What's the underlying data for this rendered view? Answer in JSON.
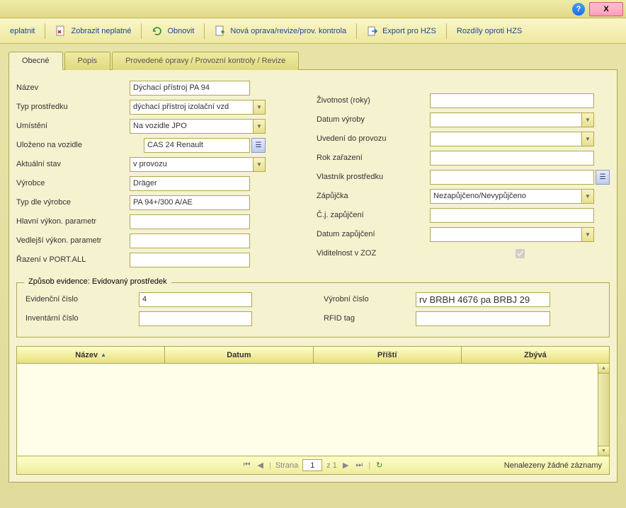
{
  "titlebar": {
    "close": "X"
  },
  "toolbar": {
    "invalidate": "eplatnit",
    "show_invalid": "Zobrazit neplatné",
    "refresh": "Obnovit",
    "new_repair": "Nová oprava/revize/prov. kontrola",
    "export_hzs": "Export pro HZS",
    "diff_hzs": "Rozdíly oproti HZS"
  },
  "tabs": {
    "general": "Obecné",
    "desc": "Popis",
    "repairs": "Provedené opravy / Provozní kontroly / Revize"
  },
  "labels": {
    "nazev": "Název",
    "typ_prostredku": "Typ prostředku",
    "umisteni": "Umístění",
    "ulozeno_vozidle": "Uloženo na vozidle",
    "aktualni_stav": "Aktuální stav",
    "vyrobce": "Výrobce",
    "typ_dle_vyrobce": "Typ dle výrobce",
    "hlavni_param": "Hlavní výkon. parametr",
    "vedlejsi_param": "Vedlejší výkon. parametr",
    "razeni": "Řazení v PORT.ALL",
    "zivotnost": "Životnost (roky)",
    "datum_vyroby": "Datum výroby",
    "uvedeni_provozu": "Uvedení do provozu",
    "rok_zarazeni": "Rok zařazení",
    "vlastnik": "Vlastník prostředku",
    "zapujcka": "Zápůjčka",
    "cj_zapujceni": "Č.j. zapůjčení",
    "datum_zapujceni": "Datum zapůjčení",
    "viditelnost": "Viditelnost v ZOZ",
    "evidencni_cislo": "Evidenční číslo",
    "inventarni_cislo": "Inventární číslo",
    "vyrobni_cislo": "Výrobní číslo",
    "rfid": "RFID tag"
  },
  "values": {
    "nazev": "Dýchací přístroj PA 94",
    "typ_prostredku": "dýchací přístroj izolační vzd",
    "umisteni": "Na vozidle JPO",
    "ulozeno_vozidle": "CAS 24 Renault",
    "aktualni_stav": "v provozu",
    "vyrobce": "Dräger",
    "typ_dle_vyrobce": "PA 94+/300 A/AE",
    "hlavni_param": "",
    "vedlejsi_param": "",
    "razeni": "",
    "zivotnost": "",
    "datum_vyroby": "",
    "uvedeni_provozu": "",
    "rok_zarazeni": "",
    "vlastnik": "",
    "zapujcka": "Nezapůjčeno/Nevypůjčeno",
    "cj_zapujceni": "",
    "datum_zapujceni": "",
    "evidencni_cislo": "4",
    "inventarni_cislo": "",
    "vyrobni_cislo": "rv BRBH 4676 pa BRBJ 29",
    "rfid": ""
  },
  "groupbox_legend": "Způsob evidence: Evidovaný prostředek",
  "grid": {
    "col_nazev": "Název",
    "col_datum": "Datum",
    "col_pristi": "Příští",
    "col_zbyva": "Zbývá",
    "page_label": "Strana",
    "page_value": "1",
    "page_total": "z 1",
    "empty": "Nenalezeny žádné záznamy"
  }
}
